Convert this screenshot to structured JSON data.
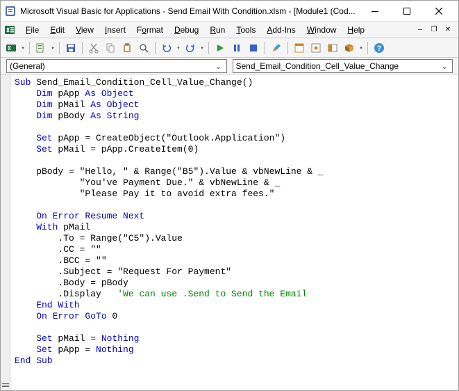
{
  "title": "Microsoft Visual Basic for Applications - Send Email With Condition.xlsm - [Module1 (Cod...",
  "menu": {
    "file": "File",
    "edit": "Edit",
    "view": "View",
    "insert": "Insert",
    "format": "Format",
    "debug": "Debug",
    "run": "Run",
    "tools": "Tools",
    "addins": "Add-Ins",
    "window": "Window",
    "help": "Help"
  },
  "dropdowns": {
    "left": "(General)",
    "right": "Send_Email_Condition_Cell_Value_Change"
  },
  "code": {
    "l01a": "Sub",
    "l01b": " Send_Email_Condition_Cell_Value_Change()",
    "l02a": "    Dim",
    "l02b": " pApp ",
    "l02c": "As Object",
    "l03a": "    Dim",
    "l03b": " pMail ",
    "l03c": "As Object",
    "l04a": "    Dim",
    "l04b": " pBody ",
    "l04c": "As String",
    "l05": "",
    "l06a": "    Set",
    "l06b": " pApp = CreateObject(\"Outlook.Application\")",
    "l07a": "    Set",
    "l07b": " pMail = pApp.CreateItem(0)",
    "l08": "",
    "l09": "    pBody = \"Hello, \" & Range(\"B5\").Value & vbNewLine & _",
    "l10": "            \"You've Payment Due.\" & vbNewLine & _",
    "l11": "            \"Please Pay it to avoid extra fees.\"",
    "l12": "",
    "l13a": "    On Error Resume Next",
    "l14a": "    With",
    "l14b": " pMail",
    "l15": "        .To = Range(\"C5\").Value",
    "l16": "        .CC = \"\"",
    "l17": "        .BCC = \"\"",
    "l18": "        .Subject = \"Request For Payment\"",
    "l19": "        .Body = pBody",
    "l20a": "        .Display   ",
    "l20b": "'We can use .Send to Send the Email",
    "l21a": "    End With",
    "l22a": "    On Error GoTo",
    "l22b": " 0",
    "l23": "",
    "l24a": "    Set",
    "l24b": " pMail = ",
    "l24c": "Nothing",
    "l25a": "    Set",
    "l25b": " pApp = ",
    "l25c": "Nothing",
    "l26a": "End Sub"
  }
}
